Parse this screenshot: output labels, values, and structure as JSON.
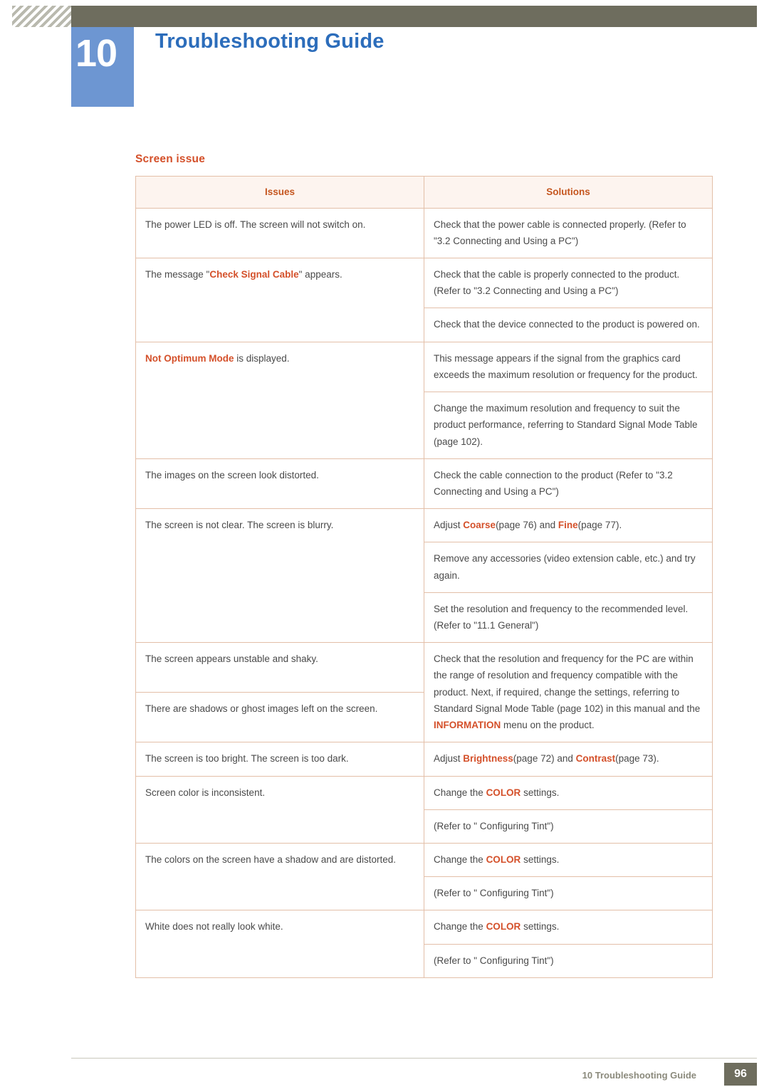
{
  "header": {
    "chapter_number": "10",
    "chapter_title": "Troubleshooting Guide"
  },
  "section": {
    "heading": "Screen issue"
  },
  "table": {
    "headers": {
      "issues": "Issues",
      "solutions": "Solutions"
    },
    "rows": [
      {
        "issue": "The power LED is off. The screen will not switch on.",
        "solutions": [
          {
            "parts": [
              {
                "text": "Check that the power cable is connected properly. (Refer to \"3.2 Connecting and Using a PC\")",
                "style": "plain"
              }
            ]
          }
        ]
      },
      {
        "issue_parts": [
          {
            "text": "The message \"",
            "style": "plain"
          },
          {
            "text": "Check Signal Cable",
            "style": "highlight"
          },
          {
            "text": "\" appears.",
            "style": "plain"
          }
        ],
        "solutions": [
          {
            "parts": [
              {
                "text": "Check that the cable is properly connected to the product. (Refer to \"3.2 Connecting and Using a PC\")",
                "style": "plain"
              }
            ]
          },
          {
            "parts": [
              {
                "text": "Check that the device connected to the product is powered on.",
                "style": "plain"
              }
            ]
          }
        ]
      },
      {
        "issue_parts": [
          {
            "text": "Not Optimum Mode",
            "style": "highlight"
          },
          {
            "text": " is displayed.",
            "style": "plain"
          }
        ],
        "solutions": [
          {
            "parts": [
              {
                "text": "This message appears if the signal from the graphics card exceeds the maximum resolution or frequency for the product.",
                "style": "plain"
              }
            ]
          },
          {
            "parts": [
              {
                "text": "Change the maximum resolution and frequency to suit the product performance, referring to Standard Signal Mode Table (page 102).",
                "style": "plain"
              }
            ]
          }
        ]
      },
      {
        "issue": "The images on the screen look distorted.",
        "solutions": [
          {
            "parts": [
              {
                "text": "Check the cable connection to the product (Refer to \"3.2 Connecting and Using a PC\")",
                "style": "plain"
              }
            ]
          }
        ]
      },
      {
        "issue": "The screen is not clear. The screen is blurry.",
        "solutions": [
          {
            "parts": [
              {
                "text": "Adjust ",
                "style": "plain"
              },
              {
                "text": "Coarse",
                "style": "highlight"
              },
              {
                "text": "(page 76) and ",
                "style": "plain"
              },
              {
                "text": "Fine",
                "style": "highlight"
              },
              {
                "text": "(page 77).",
                "style": "plain"
              }
            ]
          },
          {
            "parts": [
              {
                "text": "Remove any accessories (video extension cable, etc.) and try again.",
                "style": "plain"
              }
            ]
          },
          {
            "parts": [
              {
                "text": "Set the resolution and frequency to the recommended level. (Refer to \"11.1 General\")",
                "style": "plain"
              }
            ]
          }
        ]
      },
      {
        "issue": "The screen appears unstable and shaky.",
        "solutions": [
          {
            "parts": [
              {
                "text": "Check that the resolution and frequency for the PC are within the range of resolution and frequency compatible with the product. Next, if required, change the settings, referring to Standard Signal Mode Table (page 102) in this manual and the ",
                "style": "plain"
              },
              {
                "text": "INFORMATION",
                "style": "highlight"
              },
              {
                "text": " menu on the product.",
                "style": "plain"
              }
            ]
          }
        ]
      },
      {
        "issue": "There are shadows or ghost images left on the screen.",
        "solutions": []
      },
      {
        "issue": "The screen is too bright. The screen is too dark.",
        "solutions": [
          {
            "parts": [
              {
                "text": "Adjust ",
                "style": "plain"
              },
              {
                "text": "Brightness",
                "style": "highlight"
              },
              {
                "text": "(page 72) and ",
                "style": "plain"
              },
              {
                "text": "Contrast",
                "style": "highlight"
              },
              {
                "text": "(page 73).",
                "style": "plain"
              }
            ]
          }
        ]
      },
      {
        "issue": "Screen color is inconsistent.",
        "solutions": [
          {
            "parts": [
              {
                "text": "Change the ",
                "style": "plain"
              },
              {
                "text": "COLOR",
                "style": "highlight"
              },
              {
                "text": " settings.",
                "style": "plain"
              }
            ]
          },
          {
            "parts": [
              {
                "text": "(Refer to \" Configuring Tint\")",
                "style": "plain"
              }
            ]
          }
        ]
      },
      {
        "issue": "The colors on the screen have a shadow and are distorted.",
        "solutions": [
          {
            "parts": [
              {
                "text": "Change the ",
                "style": "plain"
              },
              {
                "text": "COLOR",
                "style": "highlight"
              },
              {
                "text": " settings.",
                "style": "plain"
              }
            ]
          },
          {
            "parts": [
              {
                "text": "(Refer to \" Configuring Tint\")",
                "style": "plain"
              }
            ]
          }
        ]
      },
      {
        "issue": "White does not really look white.",
        "solutions": [
          {
            "parts": [
              {
                "text": "Change the ",
                "style": "plain"
              },
              {
                "text": "COLOR",
                "style": "highlight"
              },
              {
                "text": " settings.",
                "style": "plain"
              }
            ]
          },
          {
            "parts": [
              {
                "text": "(Refer to \" Configuring Tint\")",
                "style": "plain"
              }
            ]
          }
        ]
      }
    ]
  },
  "footer": {
    "text": "10 Troubleshooting Guide",
    "page_number": "96"
  },
  "colors": {
    "accent_orange": "#d4502a",
    "heading_blue": "#2c6dbb",
    "badge_blue": "#6d96d2",
    "bar_olive": "#6e6d5e",
    "table_border": "#e3bfa8",
    "table_header_bg": "#fdf4ef"
  }
}
